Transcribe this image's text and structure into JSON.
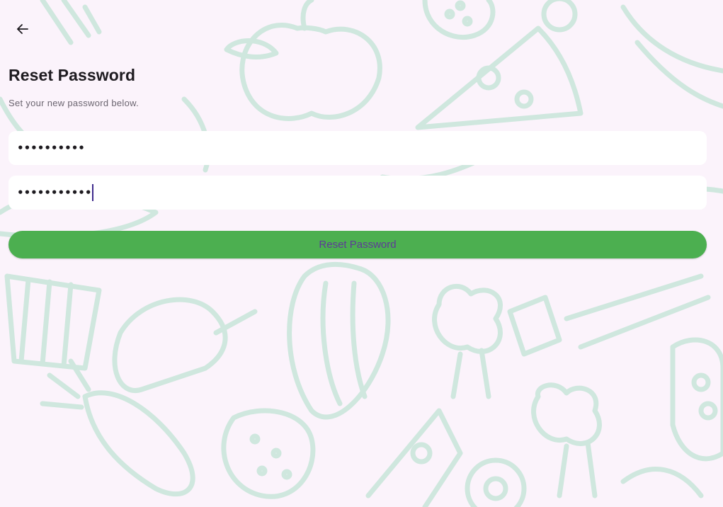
{
  "header": {
    "back_icon": "arrow-left-icon",
    "title": "Reset Password",
    "subtitle": "Set your new password below."
  },
  "form": {
    "new_password": {
      "value": "••••••••••",
      "masked": true
    },
    "confirm_password": {
      "value": "•••••••••••",
      "masked": true,
      "focused": true
    },
    "submit_label": "Reset Password"
  },
  "colors": {
    "background": "#fbf3fb",
    "pattern": "#cfe7de",
    "button": "#4caf50",
    "button_text": "#5e3b97",
    "title": "#1e1b20"
  }
}
